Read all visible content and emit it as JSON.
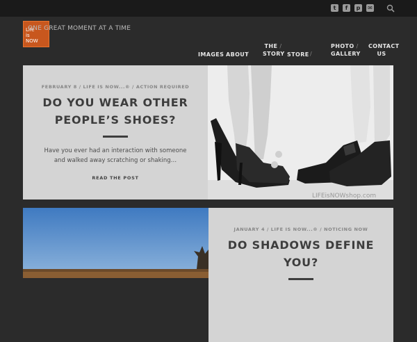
{
  "site": {
    "tagline": "ONE GREAT MOMENT AT A TIME",
    "logo_line1": "Life",
    "logo_line2": "is",
    "logo_line3": "NOW"
  },
  "social_icons": [
    "twitter-icon",
    "facebook-icon",
    "pinterest-icon",
    "email-icon"
  ],
  "nav": {
    "images": "IMAGES",
    "about": "ABOUT",
    "the": "THE",
    "story": "STORY",
    "store": "STORE",
    "photo": "PHOTO",
    "gallery": "GALLERY",
    "contact": "CONTACT",
    "us": "US",
    "sep": "/"
  },
  "posts": [
    {
      "meta": "FEBRUARY 8 / LIFE IS NOW...® / ACTION REQUIRED",
      "title_line1": "DO YOU WEAR OTHER",
      "title_line2": "PEOPLE’S SHOES?",
      "excerpt": "Have you ever had an interaction with someone and walked away scratching or shaking…",
      "read_more": "READ THE POST",
      "watermark": "LIFEisNOWshop.com"
    },
    {
      "meta": "JANUARY 4 / LIFE IS NOW...® / NOTICING NOW",
      "title_line1": "DO SHADOWS DEFINE",
      "title_line2": "YOU?"
    }
  ],
  "colors": {
    "page_bg": "#2b2b2b",
    "topbar_bg": "#1a1a1a",
    "logo": "#c8571e",
    "panel_bg": "#d4d4d4",
    "heading": "#3d3d3d"
  }
}
